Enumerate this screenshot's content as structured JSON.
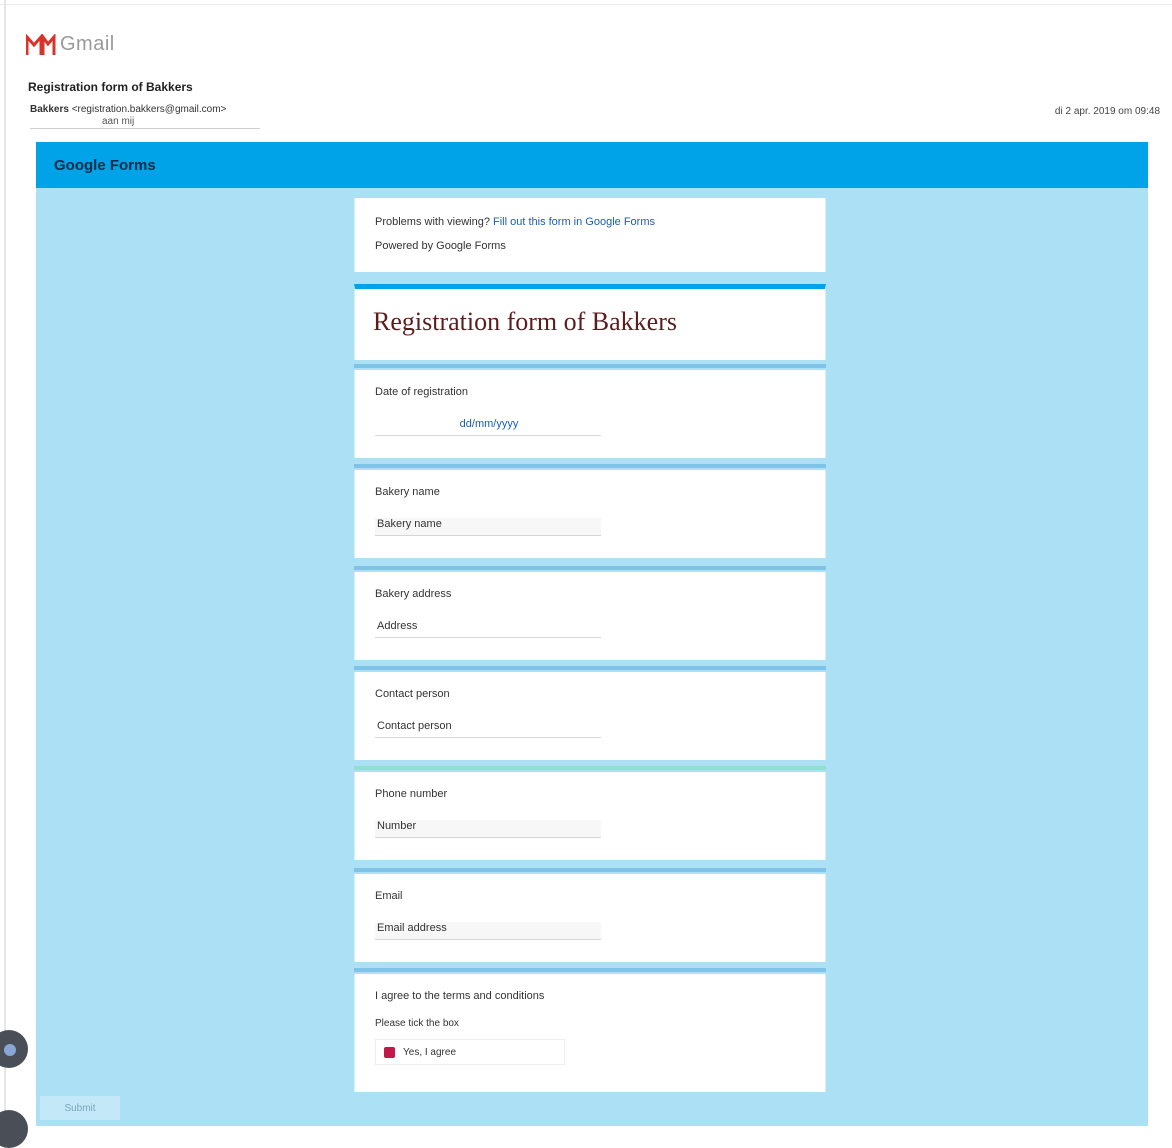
{
  "mail": {
    "logo_text": "Gmail",
    "subject": "Registration form of Bakkers",
    "sender_name": "Bakkers",
    "sender_email": "<registration.bakkers@gmail.com>",
    "sender_sub": "aan mij",
    "date": "di 2 apr. 2019 om 09:48"
  },
  "form": {
    "header": "Google Forms",
    "notice_line1_prefix": "Problems with viewing? ",
    "notice_link": "Fill out this form in Google Forms",
    "notice_line2": "Powered by Google Forms",
    "title": "Registration form of Bakkers",
    "questions": [
      {
        "label": "Date of registration",
        "value": "dd/mm/yyyy"
      },
      {
        "label": "Bakery name",
        "value": "Bakery name"
      },
      {
        "label": "Bakery address",
        "value": "Address"
      },
      {
        "label": "Contact person",
        "value": "Contact person"
      },
      {
        "label": "Phone number",
        "value": "Number"
      },
      {
        "label": "Email",
        "value": "Email address"
      }
    ],
    "last_question": {
      "label": "I agree to the terms and conditions",
      "sublabel": "Please tick the box",
      "option": "Yes, I agree"
    },
    "submit": "Submit"
  },
  "colors": {
    "header": "#00a3e8",
    "background": "#abe0f5",
    "title": "#5d1d1d",
    "checkbox": "#c2184a"
  }
}
